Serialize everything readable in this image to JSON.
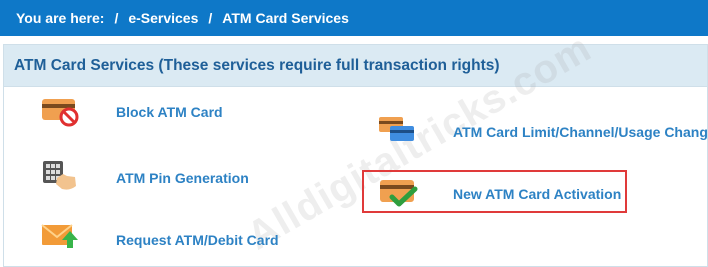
{
  "breadcrumb": {
    "prefix": "You are here:",
    "separator": "/",
    "items": [
      "e-Services",
      "ATM Card Services"
    ]
  },
  "panel": {
    "title": "ATM Card Services (These services require full transaction rights)"
  },
  "services": {
    "block": "Block ATM Card",
    "pin": "ATM Pin Generation",
    "request": "Request ATM/Debit Card",
    "limit": "ATM Card Limit/Channel/Usage Change",
    "activation": "New ATM Card Activation"
  },
  "watermark": "Alldigitaltricks.com",
  "colors": {
    "header_bg": "#0e78c8",
    "panel_header_bg": "#dbeaf3",
    "link": "#2d82c4",
    "highlight": "#e03a3a"
  }
}
